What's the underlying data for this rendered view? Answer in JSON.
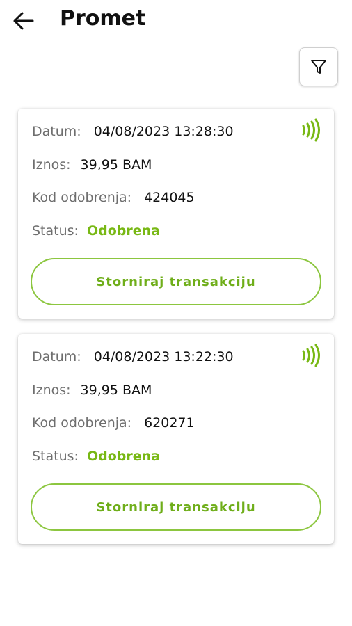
{
  "header": {
    "title": "Promet",
    "back_icon": "arrow-left-icon",
    "filter_icon": "filter-icon"
  },
  "labels": {
    "date": "Datum:",
    "amount": "Iznos:",
    "approval_code": "Kod odobrenja:",
    "status": "Status:"
  },
  "transactions": [
    {
      "date": "04/08/2023 13:28:30",
      "amount": "39,95 BAM",
      "approval_code": "424045",
      "status": "Odobrena",
      "action_label": "Storniraj transakciju",
      "icon": "contactless-icon"
    },
    {
      "date": "04/08/2023 13:22:30",
      "amount": "39,95 BAM",
      "approval_code": "620271",
      "status": "Odobrena",
      "action_label": "Storniraj transakciju",
      "icon": "contactless-icon"
    }
  ],
  "colors": {
    "accent": "#8cc63f",
    "status_ok": "#78b814",
    "label": "#6e6e6e"
  }
}
